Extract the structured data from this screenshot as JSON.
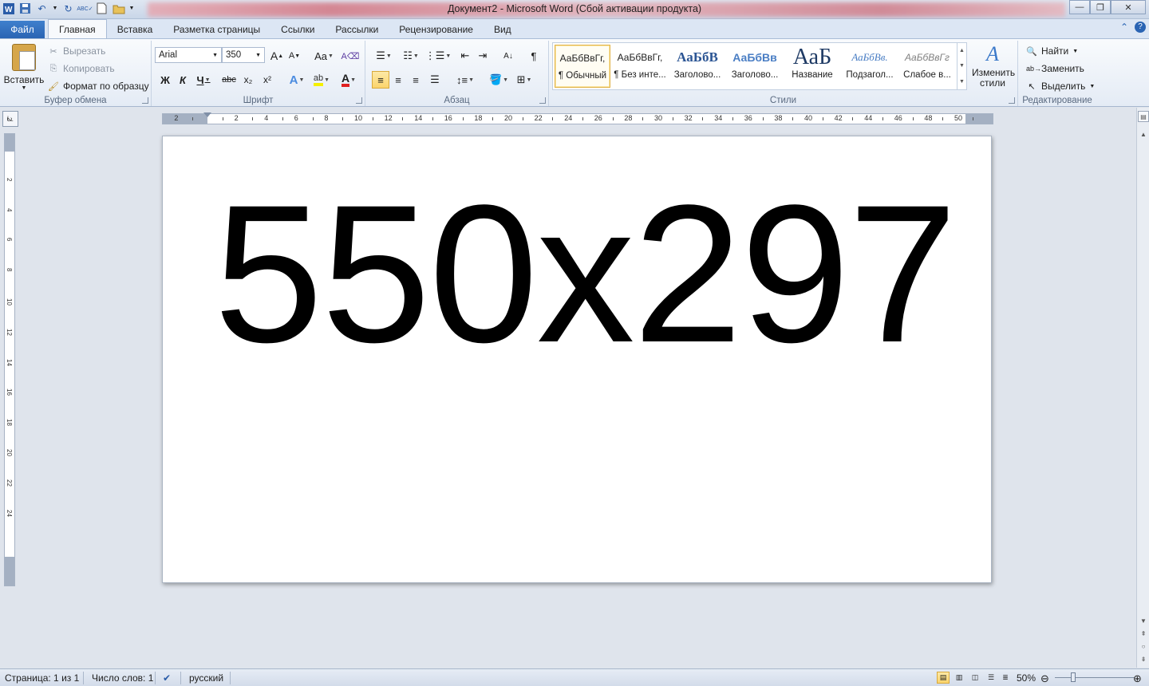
{
  "window": {
    "title": "Документ2  -  Microsoft Word (Сбой активации продукта)",
    "minimize_icon": "minimize-icon",
    "maximize_icon": "restore-icon",
    "close_icon": "close-icon"
  },
  "tabs": [
    {
      "label": "Файл"
    },
    {
      "label": "Главная"
    },
    {
      "label": "Вставка"
    },
    {
      "label": "Разметка страницы"
    },
    {
      "label": "Ссылки"
    },
    {
      "label": "Рассылки"
    },
    {
      "label": "Рецензирование"
    },
    {
      "label": "Вид"
    }
  ],
  "clipboard": {
    "paste": "Вставить",
    "cut": "Вырезать",
    "copy": "Копировать",
    "format_painter": "Формат по образцу",
    "group_label": "Буфер обмена"
  },
  "font": {
    "family": "Arial",
    "size": "350",
    "group_label": "Шрифт",
    "bold": "Ж",
    "italic": "К",
    "underline": "Ч",
    "strike": "abc",
    "subscript": "x₂",
    "superscript": "x²",
    "grow": "A",
    "shrink": "A",
    "case": "Aa",
    "color_letter": "A",
    "font_color": "#e02020",
    "highlight_color": "#f5f000"
  },
  "paragraph": {
    "group_label": "Абзац",
    "pilcrow": "¶"
  },
  "styles": {
    "group_label": "Стили",
    "items": [
      {
        "sample": "АаБбВвГг,",
        "name": "¶ Обычный"
      },
      {
        "sample": "АаБбВвГг,",
        "name": "¶ Без инте..."
      },
      {
        "sample": "АаБбВ",
        "name": "Заголово..."
      },
      {
        "sample": "АаБбВв",
        "name": "Заголово..."
      },
      {
        "sample": "АаБ",
        "name": "Название"
      },
      {
        "sample": "АаБбВв.",
        "name": "Подзагол..."
      },
      {
        "sample": "АаБбВвГг",
        "name": "Слабое в..."
      }
    ],
    "change_styles": "Изменить стили"
  },
  "editing": {
    "group_label": "Редактирование",
    "find": "Найти",
    "replace": "Заменить",
    "select": "Выделить"
  },
  "ruler": {
    "h_numbers": [
      "2",
      "2",
      "4",
      "6",
      "8",
      "10",
      "12",
      "14",
      "16",
      "18",
      "20",
      "22",
      "24",
      "26",
      "28",
      "30",
      "32",
      "34",
      "36",
      "38",
      "40",
      "42",
      "44",
      "46",
      "48",
      "50"
    ],
    "v_numbers": [
      "2",
      "2",
      "4",
      "6",
      "8",
      "10",
      "12",
      "14",
      "16",
      "18",
      "20",
      "22",
      "24"
    ]
  },
  "document": {
    "text": "550x297"
  },
  "status": {
    "page": "Страница: 1 из 1",
    "words": "Число слов: 1",
    "language": "русский",
    "zoom": "50%",
    "zoom_percent": 50
  }
}
